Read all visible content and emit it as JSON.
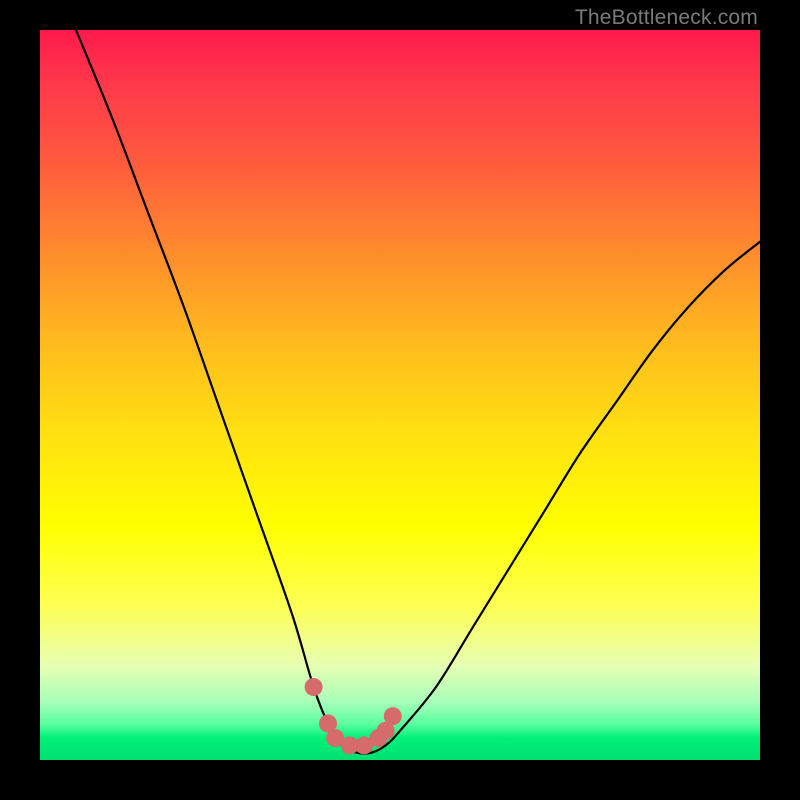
{
  "watermark": "TheBottleneck.com",
  "chart_data": {
    "type": "line",
    "title": "",
    "xlabel": "",
    "ylabel": "",
    "xlim": [
      0,
      100
    ],
    "ylim": [
      0,
      100
    ],
    "series": [
      {
        "name": "bottleneck-curve",
        "x": [
          5,
          10,
          15,
          20,
          25,
          30,
          35,
          38,
          40,
          42,
          44,
          46,
          48,
          50,
          55,
          60,
          65,
          70,
          75,
          80,
          85,
          90,
          95,
          100
        ],
        "y": [
          100,
          88,
          75,
          62,
          48,
          34,
          20,
          10,
          5,
          2,
          1,
          1,
          2,
          4,
          10,
          18,
          26,
          34,
          42,
          49,
          56,
          62,
          67,
          71
        ]
      }
    ],
    "markers": {
      "name": "highlight-dots",
      "color": "#d66b6b",
      "points": [
        {
          "x": 38,
          "y": 10
        },
        {
          "x": 40,
          "y": 5
        },
        {
          "x": 41,
          "y": 3
        },
        {
          "x": 43,
          "y": 2
        },
        {
          "x": 45,
          "y": 2
        },
        {
          "x": 47,
          "y": 3
        },
        {
          "x": 48,
          "y": 4
        },
        {
          "x": 49,
          "y": 6
        }
      ]
    }
  }
}
